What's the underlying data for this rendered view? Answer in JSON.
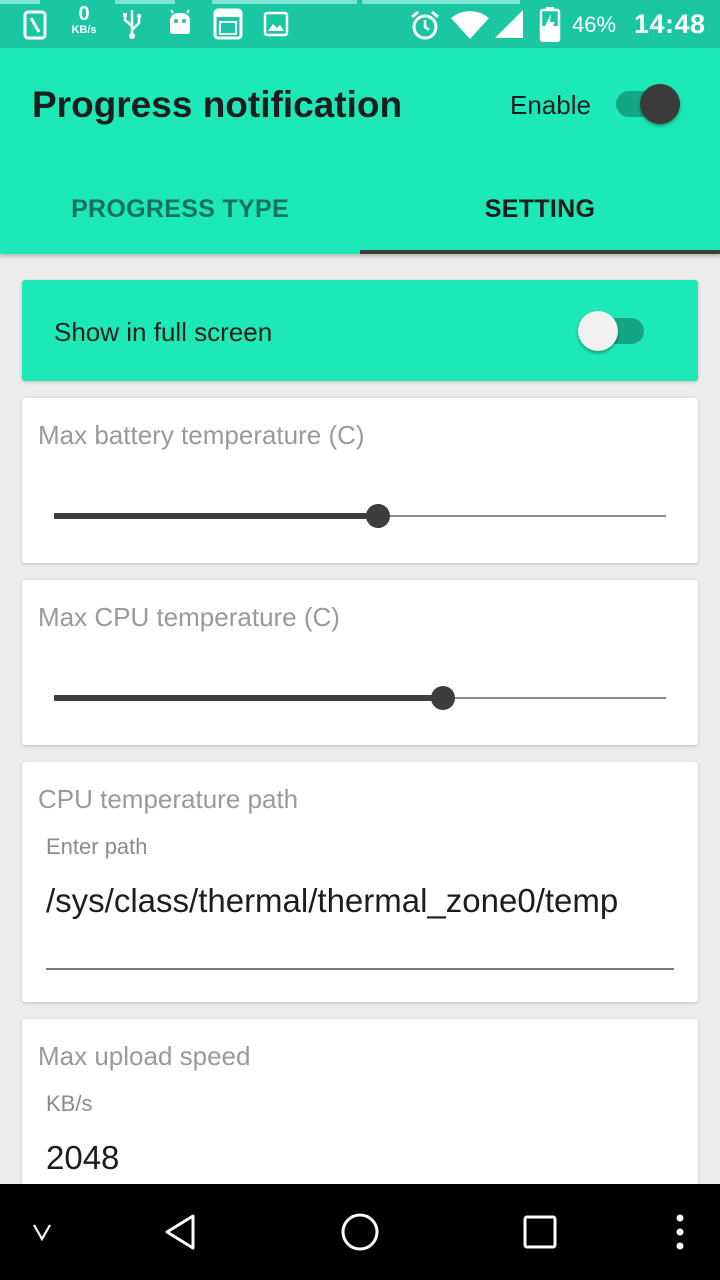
{
  "status_bar": {
    "net_speed_value": "0",
    "net_speed_unit": "KB/s",
    "battery_percent": "46%",
    "time": "14:48",
    "icons": [
      "sim-icon",
      "usb-icon",
      "android-icon",
      "screenshot-icon",
      "image-icon",
      "alarm-icon",
      "wifi-icon",
      "signal-icon",
      "battery-icon"
    ]
  },
  "app_bar": {
    "title": "Progress notification",
    "enable_label": "Enable",
    "enable_switch_on": true
  },
  "tabs": [
    {
      "label": "PROGRESS TYPE",
      "selected": false
    },
    {
      "label": "SETTING",
      "selected": true
    }
  ],
  "settings": {
    "full_screen": {
      "label": "Show in full screen",
      "on": false
    },
    "battery_temp": {
      "title": "Max battery temperature (C)",
      "slider_fraction": 0.53
    },
    "cpu_temp": {
      "title": "Max CPU temperature (C)",
      "slider_fraction": 0.635
    },
    "cpu_path": {
      "title": "CPU temperature path",
      "hint": "Enter path",
      "value": "/sys/class/thermal/thermal_zone0/temp"
    },
    "upload_speed": {
      "title": "Max upload speed",
      "hint": "KB/s",
      "value": "2048"
    }
  },
  "nav_bar": {
    "icons": [
      "dropdown-v-icon",
      "back-icon",
      "home-icon",
      "recents-icon",
      "overflow-menu-icon"
    ]
  },
  "colors": {
    "status_bar": "#1bc7a3",
    "accent": "#1de9b6",
    "slider": "#3d3d3d"
  }
}
